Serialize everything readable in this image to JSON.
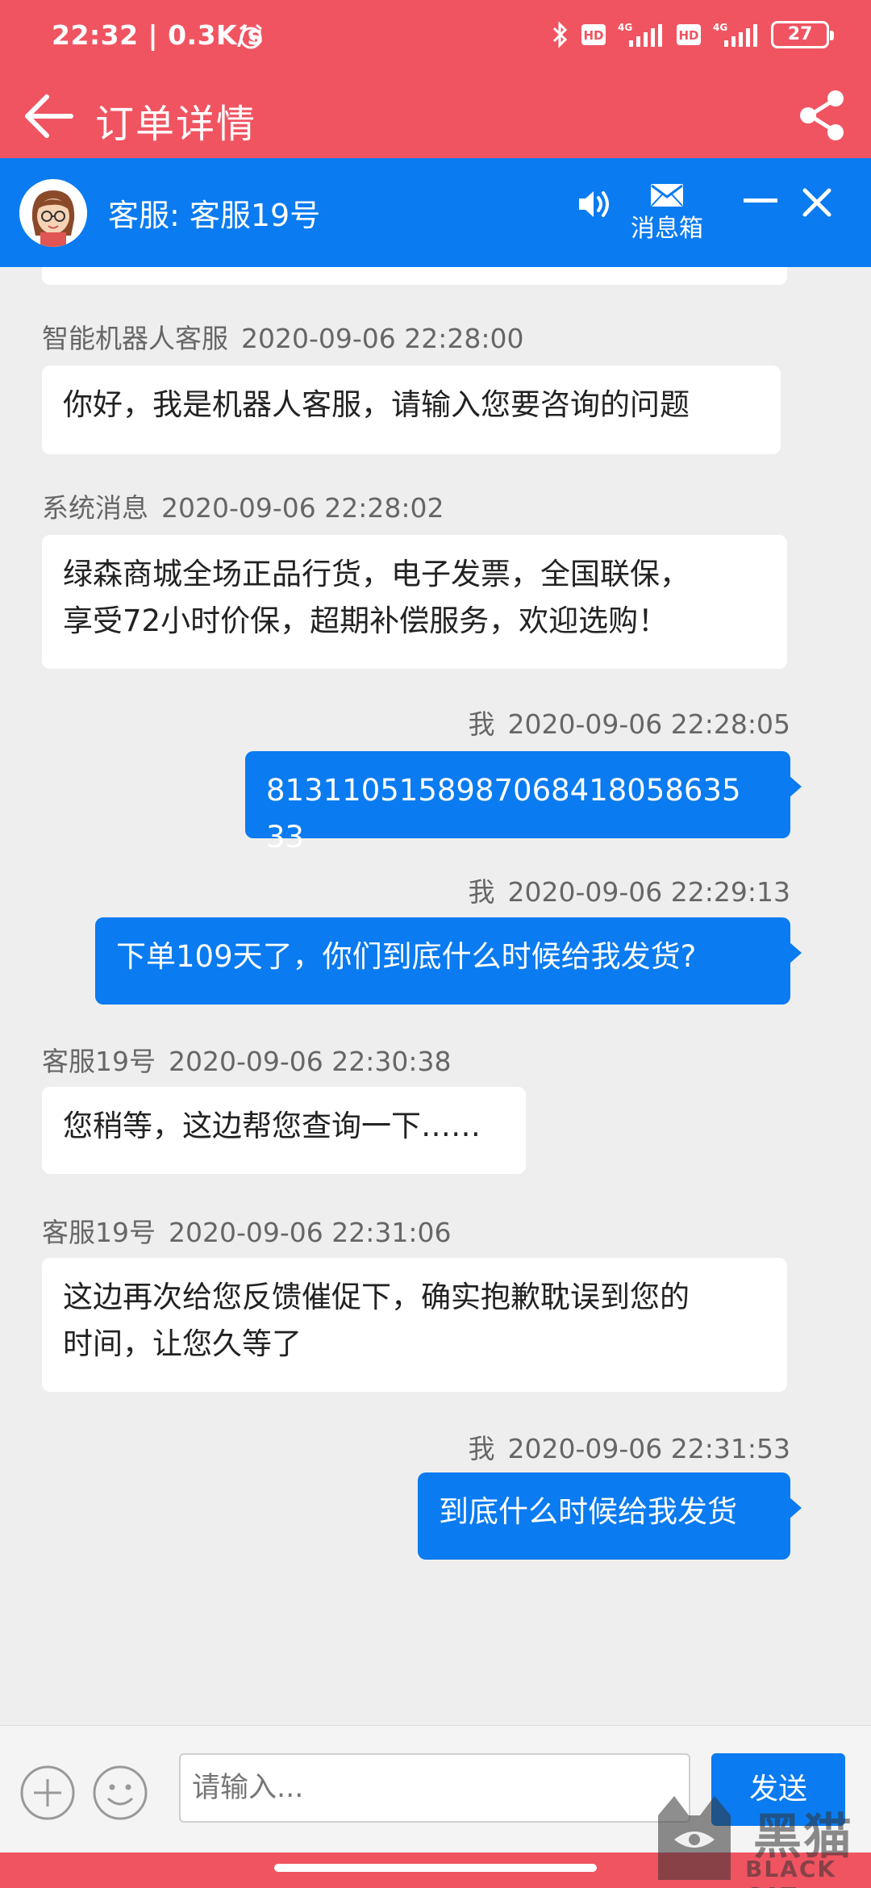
{
  "status_bar": {
    "time_speed": "22:32 | 0.3K/s",
    "network_1": "4G",
    "network_2": "4G",
    "hd_label": "HD",
    "battery": "27"
  },
  "app_bar": {
    "title": "订单详情"
  },
  "cs_bar": {
    "title": "客服: 客服19号",
    "inbox_label": "消息箱"
  },
  "messages": [
    {
      "sender": "智能机器人客服",
      "time": "2020-09-06 22:28:00",
      "text": "你好，我是机器人客服，请输入您要咨询的问题",
      "direction": "in"
    },
    {
      "sender": "系统消息",
      "time": "2020-09-06 22:28:02",
      "text_line1": "绿森商城全场正品行货，电子发票，全国联保，",
      "text_line2": "享受72小时价保，超期补偿服务，欢迎选购！",
      "direction": "in"
    },
    {
      "sender": "我",
      "time": "2020-09-06 22:28:05",
      "text": "8131105158987068418058635​33",
      "direction": "out"
    },
    {
      "sender": "我",
      "time": "2020-09-06 22:29:13",
      "text": "下单109天了，你们到底什么时候给我发货?",
      "direction": "out"
    },
    {
      "sender": "客服19号",
      "time": "2020-09-06 22:30:38",
      "text": "您稍等，这边帮您查询一下……",
      "direction": "in"
    },
    {
      "sender": "客服19号",
      "time": "2020-09-06 22:31:06",
      "text_line1": "这边再次给您反馈催促下，确实抱歉耽误到您的",
      "text_line2": "时间，让您久等了",
      "direction": "in"
    },
    {
      "sender": "我",
      "time": "2020-09-06 22:31:53",
      "text": "到底什么时候给我发货",
      "direction": "out"
    }
  ],
  "input": {
    "placeholder": "请输入...",
    "send_label": "发送"
  },
  "watermark": {
    "text": "黑猫",
    "sub": "BLACK CAT"
  },
  "colors": {
    "brand_red": "#f05461",
    "accent_blue": "#0a7bf0"
  }
}
